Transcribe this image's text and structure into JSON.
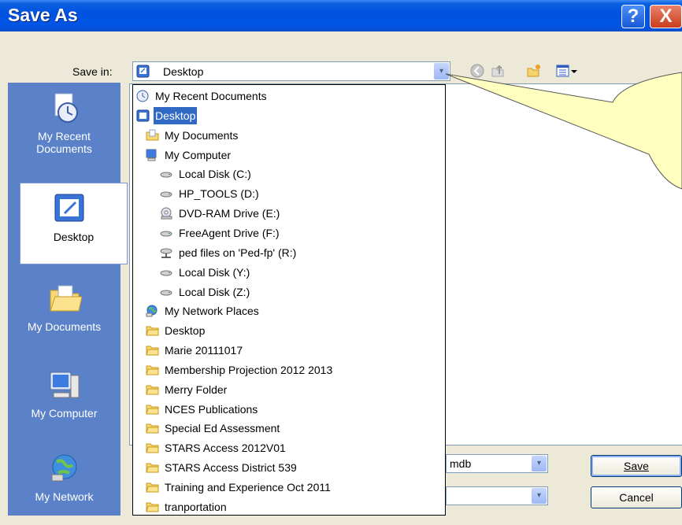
{
  "window": {
    "title": "Save As",
    "help_label": "?",
    "close_label": "X"
  },
  "save_in": {
    "label": "Save in:",
    "value": "Desktop",
    "arrow": "▾"
  },
  "places": [
    {
      "label": "My Recent\nDocuments",
      "icon": "recent-documents-icon"
    },
    {
      "label": "Desktop",
      "icon": "desktop-icon"
    },
    {
      "label": "My Documents",
      "icon": "my-documents-icon"
    },
    {
      "label": "My Computer",
      "icon": "my-computer-icon"
    },
    {
      "label": "My Network",
      "icon": "network-places-icon"
    }
  ],
  "dropdown_items": [
    {
      "label": "My Recent Documents",
      "icon": "recent-documents-icon",
      "level": 0
    },
    {
      "label": "Desktop",
      "icon": "desktop-icon",
      "level": 0,
      "selected": true
    },
    {
      "label": "My Documents",
      "icon": "my-documents-icon",
      "level": 1
    },
    {
      "label": "My Computer",
      "icon": "my-computer-icon",
      "level": 1
    },
    {
      "label": "Local Disk (C:)",
      "icon": "drive-icon",
      "level": 2
    },
    {
      "label": "HP_TOOLS (D:)",
      "icon": "drive-icon",
      "level": 2
    },
    {
      "label": "DVD-RAM Drive (E:)",
      "icon": "dvd-drive-icon",
      "level": 2
    },
    {
      "label": "FreeAgent Drive (F:)",
      "icon": "drive-icon",
      "level": 2
    },
    {
      "label": "ped files on 'Ped-fp' (R:)",
      "icon": "network-drive-icon",
      "level": 2
    },
    {
      "label": "Local Disk (Y:)",
      "icon": "drive-icon",
      "level": 2
    },
    {
      "label": "Local Disk (Z:)",
      "icon": "drive-icon",
      "level": 2
    },
    {
      "label": "My Network Places",
      "icon": "network-places-icon",
      "level": 1
    },
    {
      "label": "Desktop",
      "icon": "folder-icon",
      "level": 1
    },
    {
      "label": "Marie 20111017",
      "icon": "folder-icon",
      "level": 1
    },
    {
      "label": "Membership Projection 2012 2013",
      "icon": "folder-icon",
      "level": 1
    },
    {
      "label": "Merry Folder",
      "icon": "folder-icon",
      "level": 1
    },
    {
      "label": "NCES Publications",
      "icon": "folder-icon",
      "level": 1
    },
    {
      "label": "Special Ed Assessment",
      "icon": "folder-icon",
      "level": 1
    },
    {
      "label": "STARS Access 2012V01",
      "icon": "folder-icon",
      "level": 1
    },
    {
      "label": "STARS Access District 539",
      "icon": "folder-icon",
      "level": 1
    },
    {
      "label": "Training and Experience Oct 2011",
      "icon": "folder-icon",
      "level": 1
    },
    {
      "label": "tranportation",
      "icon": "folder-icon",
      "level": 1
    }
  ],
  "file_name": {
    "value_visible": "mdb"
  },
  "buttons": {
    "save": "Save",
    "cancel": "Cancel"
  },
  "colors": {
    "titlebar": "#0053df",
    "places_bar": "#5b82c8",
    "selection": "#316ac5",
    "callout_fill": "#ffffc0"
  }
}
